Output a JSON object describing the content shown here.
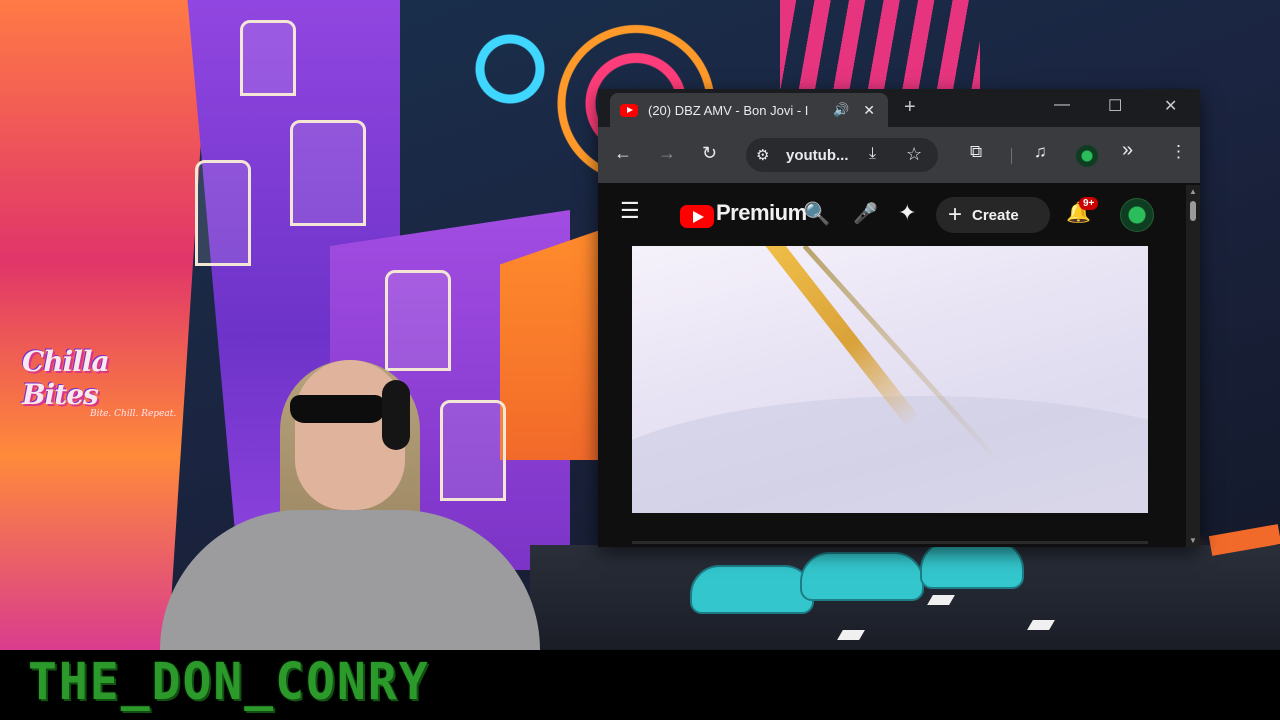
{
  "overlay": {
    "logo_main": "Chilla Bites",
    "logo_tag": "Bite. Chill. Repeat.",
    "streamer_name": "THE_DON_CONRY"
  },
  "browser": {
    "tab": {
      "title": "(20) DBZ AMV - Bon Jovi - I",
      "audio_icon": "🔊",
      "close_icon": "✕"
    },
    "new_tab_icon": "+",
    "window_controls": {
      "minimize": "—",
      "maximize": "☐",
      "close": "✕"
    },
    "toolbar": {
      "back": "←",
      "forward": "→",
      "reload": "↻",
      "address_text": "youtub...",
      "tune_icon": "⚙",
      "install_icon": "⤓",
      "bookmark_icon": "☆",
      "extensions_icon": "⧉",
      "media_icon": "♫",
      "overflow_icon": "»",
      "menu_icon": "⋮"
    }
  },
  "youtube": {
    "menu_icon": "☰",
    "brand": "Premium",
    "search_icon": "🔍",
    "mic_icon": "🎤",
    "ai_icon": "✦",
    "create_plus": "+",
    "create_label": "Create",
    "bell_icon": "🔔",
    "notification_badge": "9+"
  },
  "colors": {
    "youtube_red": "#ff0000",
    "browser_bg": "#202124",
    "page_bg": "#0f0f0f",
    "streamer_green": "#2b9a2b"
  }
}
